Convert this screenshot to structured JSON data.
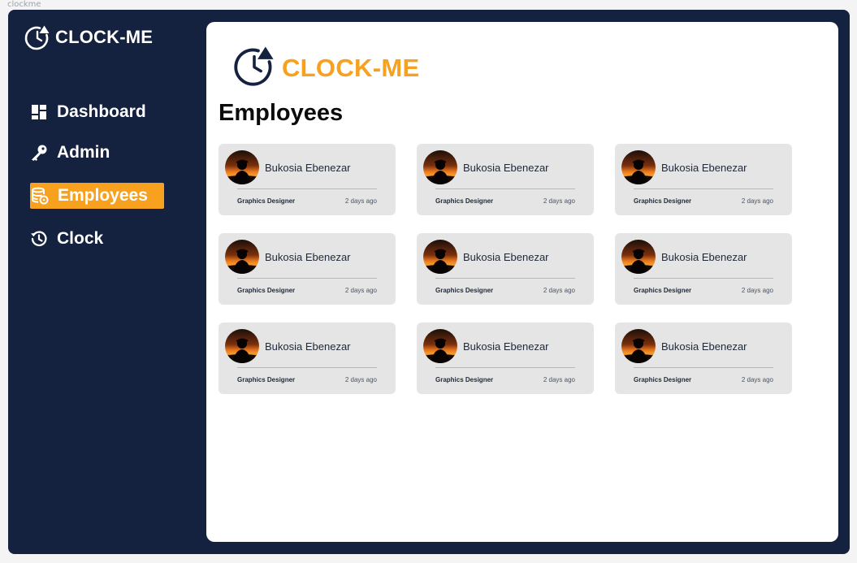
{
  "frame_label": "clockme",
  "brand": {
    "name": "CLOCK-ME",
    "accent_color": "#f7a11f",
    "navy_color": "#14213f"
  },
  "sidebar": {
    "items": [
      {
        "label": "Dashboard",
        "icon": "dashboard-icon",
        "active": false
      },
      {
        "label": "Admin",
        "icon": "key-icon",
        "active": false
      },
      {
        "label": "Employees",
        "icon": "employees-icon",
        "active": true
      },
      {
        "label": "Clock",
        "icon": "history-icon",
        "active": false
      }
    ]
  },
  "main": {
    "title": "Employees",
    "employees": [
      {
        "name": "Bukosia Ebenezar",
        "role": "Graphics Designer",
        "time": "2 days ago"
      },
      {
        "name": "Bukosia Ebenezar",
        "role": "Graphics Designer",
        "time": "2 days ago"
      },
      {
        "name": "Bukosia Ebenezar",
        "role": "Graphics Designer",
        "time": "2 days ago"
      },
      {
        "name": "Bukosia Ebenezar",
        "role": "Graphics Designer",
        "time": "2 days ago"
      },
      {
        "name": "Bukosia Ebenezar",
        "role": "Graphics Designer",
        "time": "2 days ago"
      },
      {
        "name": "Bukosia Ebenezar",
        "role": "Graphics Designer",
        "time": "2 days ago"
      },
      {
        "name": "Bukosia Ebenezar",
        "role": "Graphics Designer",
        "time": "2 days ago"
      },
      {
        "name": "Bukosia Ebenezar",
        "role": "Graphics Designer",
        "time": "2 days ago"
      },
      {
        "name": "Bukosia Ebenezar",
        "role": "Graphics Designer",
        "time": "2 days ago"
      }
    ]
  }
}
